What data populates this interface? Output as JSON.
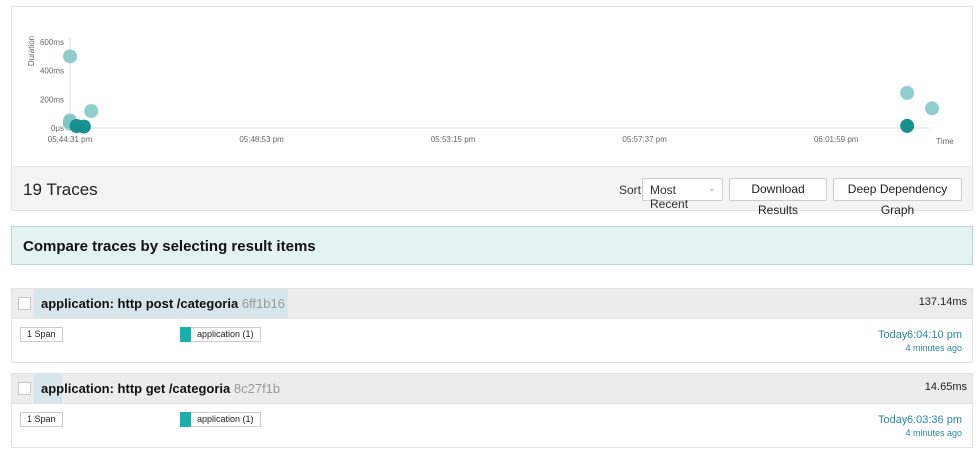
{
  "chart_data": {
    "type": "scatter",
    "ylabel": "Duration",
    "xlabel": "Time",
    "y_ticks": [
      "0μs",
      "200ms",
      "400ms",
      "600ms"
    ],
    "y_tick_values": [
      0,
      200,
      400,
      600
    ],
    "x_ticks": [
      "05:44:31 pm",
      "05:48:53 pm",
      "05:53:15 pm",
      "05:57:37 pm",
      "06:01:59 pm"
    ],
    "ylim": [
      0,
      600
    ],
    "points": [
      {
        "x": "05:44:31 pm",
        "y": 500
      },
      {
        "x": "05:45:00 pm",
        "y": 118
      },
      {
        "x": "05:44:31 pm",
        "y": 52
      },
      {
        "x": "05:44:31 pm",
        "y": 42
      },
      {
        "x": "05:44:31 pm",
        "y": 30
      },
      {
        "x": "05:44:40 pm",
        "y": 14
      },
      {
        "x": "05:44:50 pm",
        "y": 10
      },
      {
        "x": "06:03:36 pm",
        "y": 245
      },
      {
        "x": "06:04:10 pm",
        "y": 137.14
      },
      {
        "x": "06:03:36 pm",
        "y": 14.65
      }
    ],
    "colors": {
      "light": "#7cc5c4",
      "dark": "#17918f"
    }
  },
  "toolbar": {
    "trace_count": "19 Traces",
    "sort_label": "Sort:",
    "sort_value": "Most Recent",
    "download_label": "Download Results",
    "ddg_label": "Deep Dependency Graph"
  },
  "compare": {
    "text": "Compare traces by selecting result items"
  },
  "traces": [
    {
      "title": "application: http post /categoria",
      "trace_id": "6ff1b16",
      "duration": "137.14ms",
      "span_count": "1 Span",
      "service": "application (1)",
      "day": "Today",
      "time": "6:04:10 pm",
      "ago": "4 minutes ago",
      "bar_fraction": 0.27
    },
    {
      "title": "application: http get /categoria",
      "trace_id": "8c27f1b",
      "duration": "14.65ms",
      "span_count": "1 Span",
      "service": "application (1)",
      "day": "Today",
      "time": "6:03:36 pm",
      "ago": "4 minutes ago",
      "bar_fraction": 0.03
    }
  ]
}
